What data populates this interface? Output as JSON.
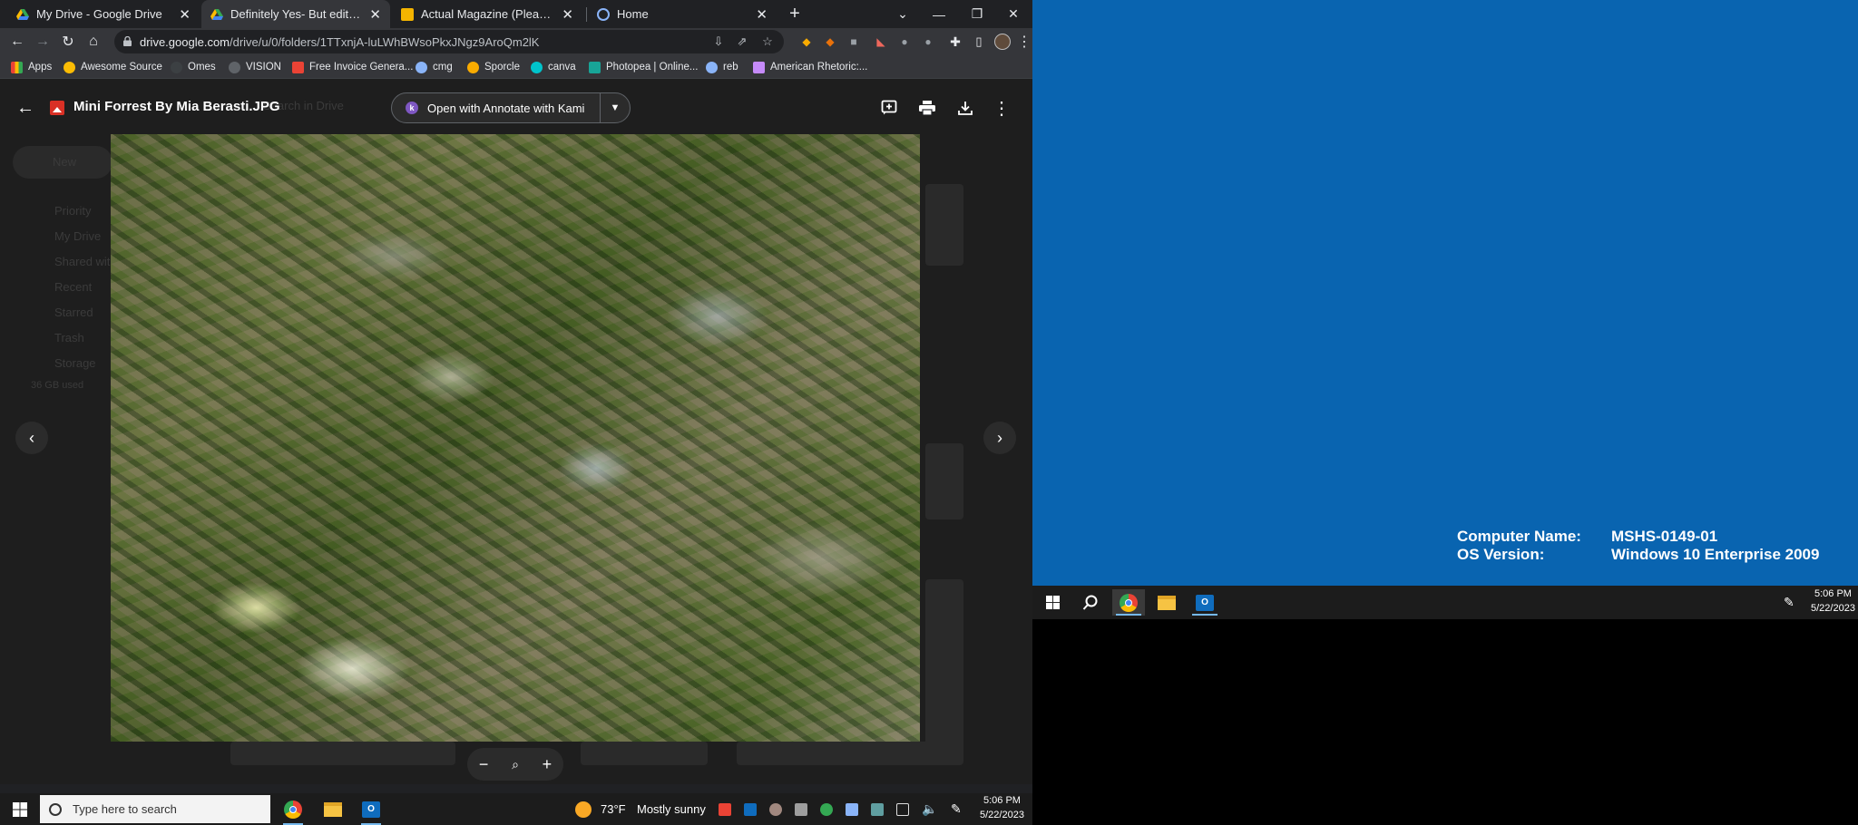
{
  "browser": {
    "tabs": [
      {
        "title": "My Drive - Google Drive",
        "favicon": "drive-icon",
        "active": false
      },
      {
        "title": "Definitely Yes- But edit. - Google",
        "favicon": "drive-icon",
        "active": true
      },
      {
        "title": "Actual Magazine (Please Touch)",
        "favicon": "slides-icon",
        "active": false
      },
      {
        "title": "Home",
        "favicon": "home-site-icon",
        "active": false
      }
    ],
    "new_tab_glyph": "+",
    "url_host": "drive.google.com",
    "url_path": "/drive/u/0/folders/1TTxnjA-luLWhBWsoPkxJNgz9AroQm2lK",
    "bookmarks": [
      {
        "label": "Apps",
        "color": "#ea4335"
      },
      {
        "label": "Awesome Source",
        "color": "#fbbc04"
      },
      {
        "label": "Omes",
        "color": "#9aa0a6"
      },
      {
        "label": "VISION",
        "color": "#5f6368"
      },
      {
        "label": "Free Invoice Genera...",
        "color": "#ea4335"
      },
      {
        "label": "cmg",
        "color": "#8ab4f8"
      },
      {
        "label": "Sporcle",
        "color": "#f9ab00"
      },
      {
        "label": "canva",
        "color": "#00c4cc"
      },
      {
        "label": "Photopea | Online...",
        "color": "#18a497"
      },
      {
        "label": "reb",
        "color": "#8ab4f8"
      },
      {
        "label": "American Rhetoric:...",
        "color": "#c58af9"
      }
    ]
  },
  "viewer": {
    "file_name": "Mini Forrest By Mia Berasti.JPG",
    "open_with_label": "Open with Annotate with Kami",
    "kami_letter": "k",
    "zoom_out": "−",
    "zoom_in": "+",
    "background_ghost": {
      "new_button": "New",
      "nav": [
        "Priority",
        "My Drive",
        "Shared with me",
        "Recent",
        "Starred",
        "Trash",
        "Storage"
      ],
      "storage_text": "36 GB used",
      "search_placeholder": "Search in Drive"
    }
  },
  "taskbar_left": {
    "search_placeholder": "Type here to search",
    "weather_temp": "73°F",
    "weather_text": "Mostly sunny",
    "time": "5:06 PM",
    "date": "5/22/2023"
  },
  "desktop_right": {
    "computer_name_label": "Computer Name:",
    "computer_name_value": "MSHS-0149-01",
    "os_version_label": "OS Version:",
    "os_version_value": "Windows 10 Enterprise 2009",
    "time": "5:06 PM",
    "date": "5/22/2023"
  }
}
